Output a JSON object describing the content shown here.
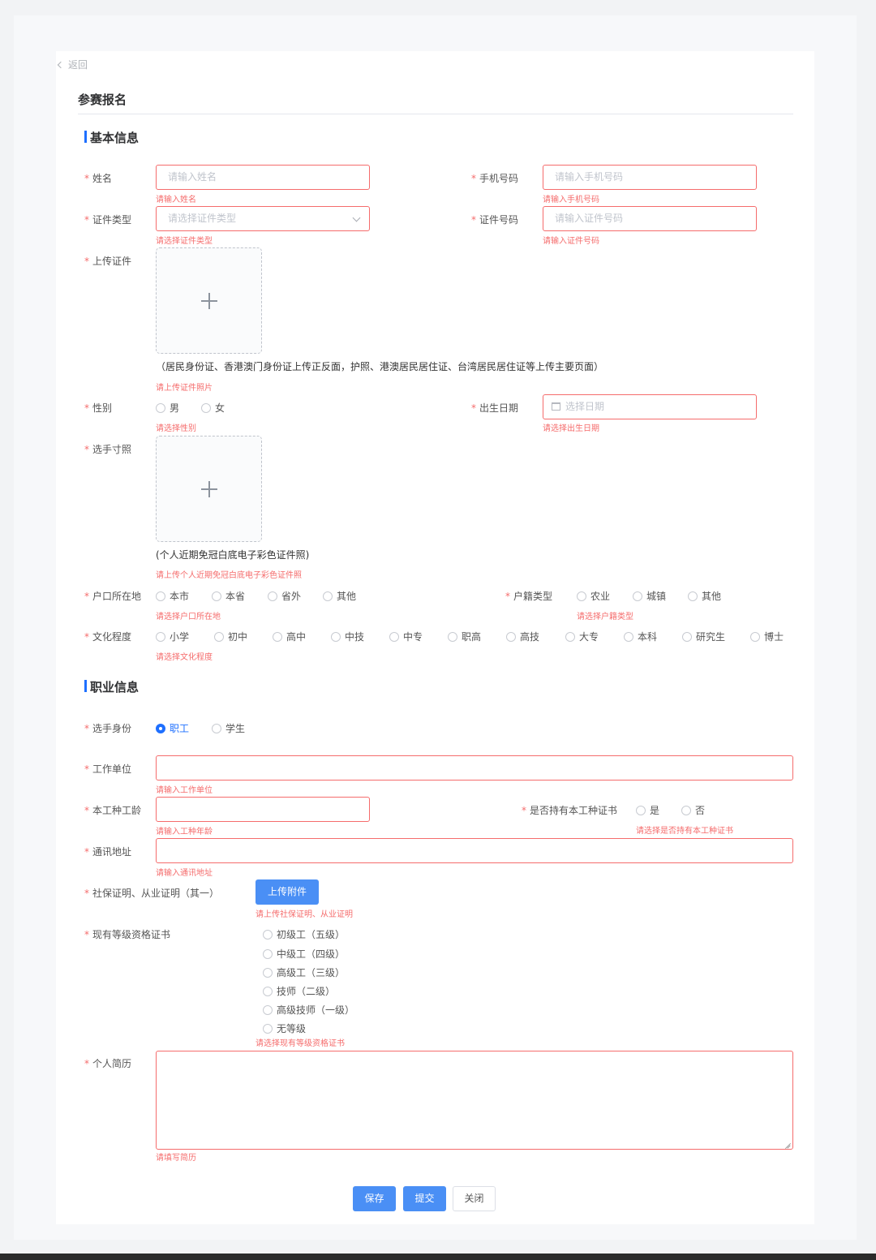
{
  "header": {
    "back_label": "返回",
    "title": "参赛报名"
  },
  "basic_section": {
    "title": "基本信息",
    "name": {
      "label": "姓名",
      "placeholder": "请输入姓名",
      "error": "请输入姓名"
    },
    "phone": {
      "label": "手机号码",
      "placeholder": "请输入手机号码",
      "error": "请输入手机号码"
    },
    "id_type": {
      "label": "证件类型",
      "placeholder": "请选择证件类型",
      "error": "请选择证件类型"
    },
    "id_number": {
      "label": "证件号码",
      "placeholder": "请输入证件号码",
      "error": "请输入证件号码"
    },
    "id_upload": {
      "label": "上传证件",
      "note": "（居民身份证、香港澳门身份证上传正反面，护照、港澳居民居住证、台湾居民居住证等上传主要页面）",
      "error": "请上传证件照片"
    },
    "gender": {
      "label": "性别",
      "options": [
        "男",
        "女"
      ],
      "error": "请选择性别"
    },
    "birthday": {
      "label": "出生日期",
      "placeholder": "选择日期",
      "error": "请选择出生日期"
    },
    "photo_upload": {
      "label": "选手寸照",
      "note": "(个人近期免冠白底电子彩色证件照)",
      "error": "请上传个人近期免冠白底电子彩色证件照"
    },
    "hukou_location": {
      "label": "户口所在地",
      "options": [
        "本市",
        "本省",
        "省外",
        "其他"
      ],
      "error": "请选择户口所在地"
    },
    "hukou_type": {
      "label": "户籍类型",
      "options": [
        "农业",
        "城镇",
        "其他"
      ],
      "error": "请选择户籍类型"
    },
    "education": {
      "label": "文化程度",
      "options": [
        "小学",
        "初中",
        "高中",
        "中技",
        "中专",
        "职高",
        "高技",
        "大专",
        "本科",
        "研究生",
        "博士"
      ],
      "error": "请选择文化程度"
    }
  },
  "career_section": {
    "title": "职业信息",
    "identity": {
      "label": "选手身份",
      "options": [
        "职工",
        "学生"
      ],
      "selected": "职工"
    },
    "employer": {
      "label": "工作单位",
      "error": "请输入工作单位"
    },
    "work_years": {
      "label": "本工种工龄",
      "error": "请输入工种年龄"
    },
    "has_certificate": {
      "label": "是否持有本工种证书",
      "options": [
        "是",
        "否"
      ],
      "error": "请选择是否持有本工种证书"
    },
    "address": {
      "label": "通讯地址",
      "error": "请输入通讯地址"
    },
    "proof": {
      "label": "社保证明、从业证明（其一）",
      "button": "上传附件",
      "error": "请上传社保证明、从业证明"
    },
    "qualification": {
      "label": "现有等级资格证书",
      "options": [
        "初级工（五级）",
        "中级工（四级）",
        "高级工（三级）",
        "技师（二级）",
        "高级技师（一级）",
        "无等级"
      ],
      "error": "请选择现有等级资格证书"
    },
    "resume": {
      "label": "个人简历",
      "error": "请填写简历"
    }
  },
  "actions": {
    "save": "保存",
    "submit": "提交",
    "close": "关闭"
  },
  "colors": {
    "primary": "#1e6fff",
    "error": "#f56c6c",
    "button": "#4a8ff5"
  }
}
